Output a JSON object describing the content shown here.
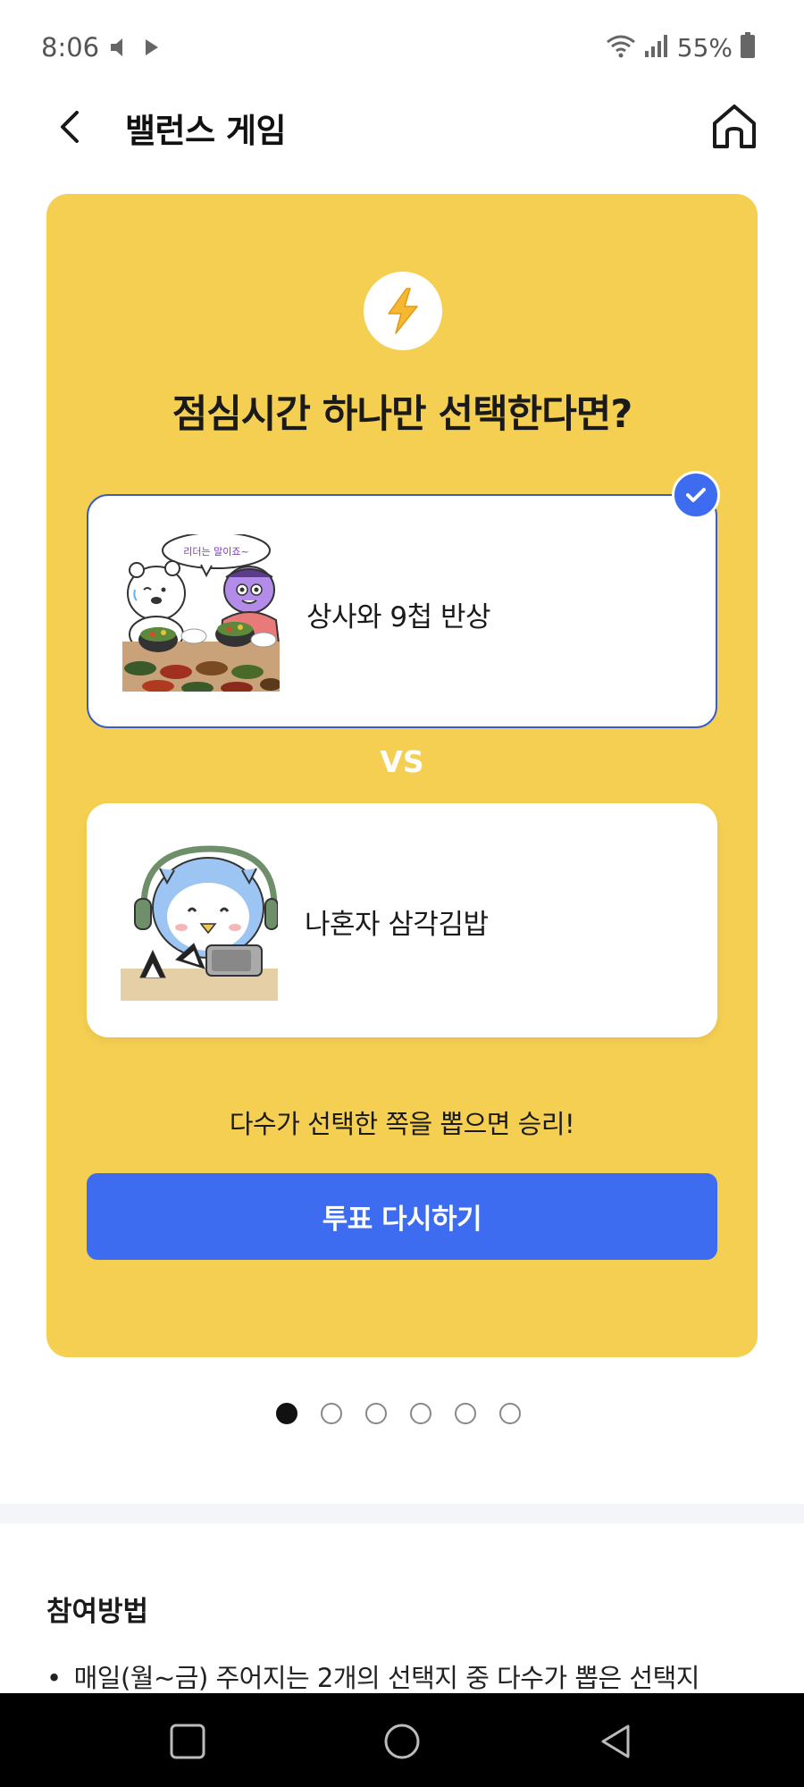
{
  "status_bar": {
    "time": "8:06",
    "battery_percent": "55%",
    "icons": [
      "mute-icon",
      "play-icon",
      "wifi-icon",
      "signal-icon",
      "battery-icon"
    ]
  },
  "header": {
    "title": "밸런스 게임",
    "back_icon": "back-arrow-icon",
    "home_icon": "home-icon"
  },
  "game": {
    "icon": "lightning-icon",
    "question": "점심시간 하나만 선택한다면?",
    "options": [
      {
        "label": "상사와 9첩 반상",
        "selected": true,
        "image": "korean-banquet-illustration",
        "speech_text": "리더는 말이죠~"
      },
      {
        "label": "나혼자 삼각김밥",
        "selected": false,
        "image": "owl-with-kimbap-illustration"
      }
    ],
    "vs_label": "VS",
    "hint": "다수가 선택한 쪽을 뽑으면 승리!",
    "revote_button": "투표 다시하기"
  },
  "pagination": {
    "total": 6,
    "current": 1
  },
  "how_to": {
    "title": "참여방법",
    "items": [
      "매일(월~금) 주어지는 2개의 선택지 중 다수가 뽑은 선택지"
    ]
  },
  "colors": {
    "card_bg": "#f4cf52",
    "accent_blue": "#3d6cf0",
    "selected_border": "#3a5cc7"
  },
  "nav_bar": {
    "icons": [
      "recent-apps-icon",
      "home-circle-icon",
      "back-triangle-icon"
    ]
  }
}
